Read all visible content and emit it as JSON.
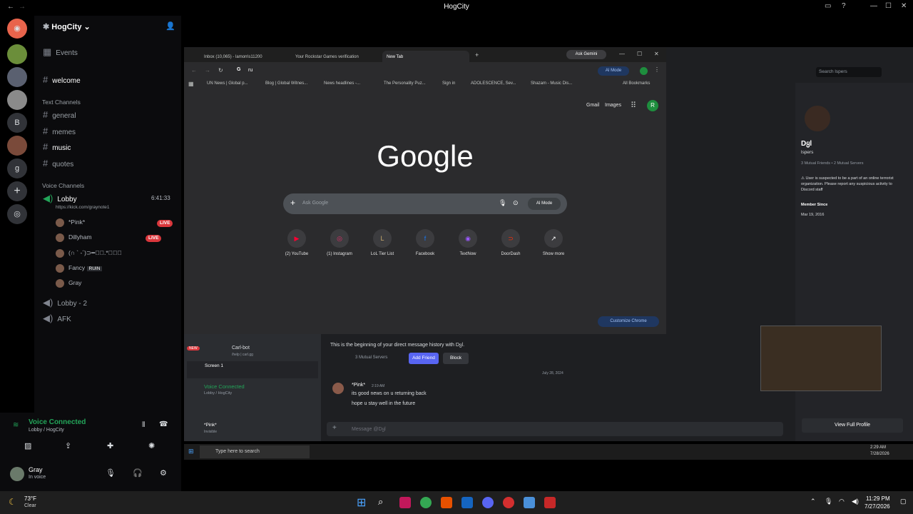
{
  "window": {
    "title": "HogCity"
  },
  "server": {
    "name": "HogCity"
  },
  "rail": {
    "items": [
      "B",
      "g"
    ]
  },
  "channels": {
    "welcome": "welcome",
    "text_category": "Text Channels",
    "text": [
      "general",
      "memes",
      "music",
      "quotes"
    ],
    "voice_category": "Voice Channels",
    "lobby": {
      "name": "Lobby",
      "timer": "6:41:33",
      "status": "https://kick.com/graynote1"
    },
    "voice_users": [
      {
        "name": "*Pink*",
        "badge": "LIVE"
      },
      {
        "name": "Dillyham",
        "badge": "LIVE"
      },
      {
        "name": "(∩ ` -´)⊃━☆ﾟ.*･｡ﾟ",
        "badge": ""
      },
      {
        "name": "Fancy",
        "badge": "RUIN"
      },
      {
        "name": "Gray",
        "badge": ""
      }
    ],
    "other_voice": [
      "Lobby - 2",
      "AFK"
    ]
  },
  "voice": {
    "status": "Voice Connected",
    "location": "Lobby / HogCity"
  },
  "user": {
    "name": "Gray",
    "status": "In voice"
  },
  "weather": {
    "temp": "73°F",
    "cond": "Clear"
  },
  "clock": {
    "time": "11:29 PM",
    "date": "7/27/2026"
  },
  "chrome": {
    "tabs": [
      "Inbox (10,065) - lamorris11200",
      "Your Rockstar Games verification",
      "New Tab"
    ],
    "ask_gemini": "Ask Gemini",
    "url_text": "ru",
    "ai_mode": "AI Mode",
    "bookmarks": [
      "UN News | Global p...",
      "Blog | Global Witnes...",
      "News headlines -...",
      "The Personality Puz...",
      "Sign in",
      "ADOLESCENCE, Sev...",
      "Shazam - Music Dis..."
    ],
    "all_bookmarks": "All Bookmarks",
    "gmail": "Gmail",
    "images": "Images",
    "avatar": "R",
    "logo": "Google",
    "search_placeholder": "Ask Google",
    "shortcuts": [
      "(2) YouTube",
      "(1) Instagram",
      "LoL Tier List",
      "Facebook",
      "TextNow",
      "DoorDash",
      "Show more"
    ],
    "customize": "Customize Chrome"
  },
  "dm": {
    "search": "Search lspers",
    "profile_name": "Dყl",
    "profile_user": "lspers",
    "profile_mutuals": "3 Mutual Friends • 2 Mutual Servers",
    "profile_note": "⚠ User is suspected to be a part of an online terrorist organization. Please report any suspicious activity to Discord staff",
    "member_since_label": "Member Since",
    "member_since": "Mar 19, 2016",
    "full_profile": "View Full Profile",
    "beginning": "This is the beginning of your direct message history with Dყl.",
    "mutual_servers": "3 Mutual Servers",
    "add_friend": "Add Friend",
    "block": "Block",
    "date_divider": "July 28, 2024",
    "msg_author": "*Pink*",
    "msg_time": "2:19 AM",
    "msg_lines": [
      "its good news on u returning back",
      "hope u stay well in the future"
    ],
    "input_placeholder": "Message @Dყl",
    "screen": "Screen 1",
    "voice_connected": "Voice Connected",
    "voice_loc": "Lobby / HogCity",
    "small_user": "*Pink*",
    "small_status": "Invisible",
    "carl": "Carl-bot",
    "carl_sub": "/help | carl.gg",
    "new_badge": "NEW"
  },
  "inner_taskbar": {
    "search": "Type here to search",
    "time": "2:29 AM",
    "date": "7/28/2026"
  }
}
